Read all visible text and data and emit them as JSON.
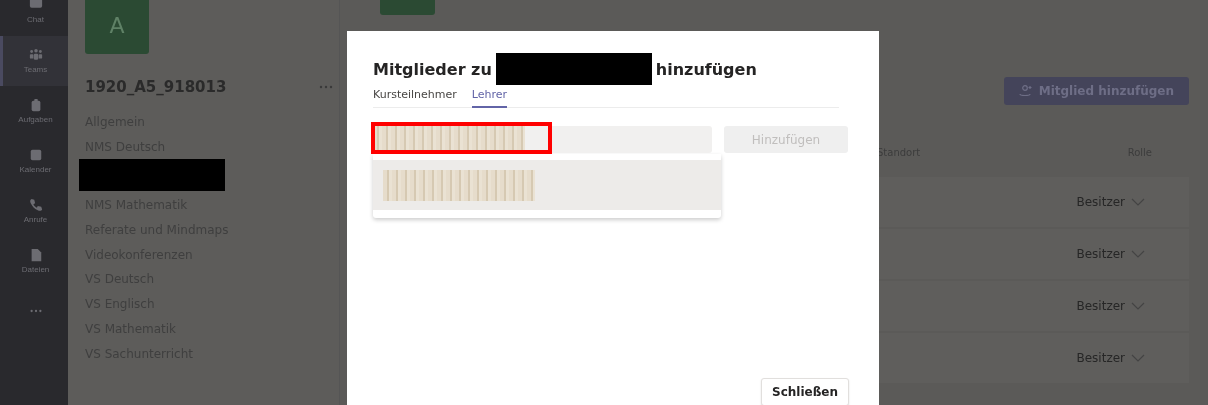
{
  "rail": {
    "items": [
      {
        "kind": "app",
        "label": "Chat",
        "selected": false
      },
      {
        "kind": "app",
        "label": "Teams",
        "selected": true
      },
      {
        "kind": "app",
        "label": "Aufgaben",
        "selected": false
      },
      {
        "kind": "app",
        "label": "Kalender",
        "selected": false
      },
      {
        "kind": "app",
        "label": "Anrufe",
        "selected": false
      },
      {
        "kind": "app",
        "label": "Dateien",
        "selected": false
      },
      {
        "kind": "more"
      }
    ]
  },
  "team": {
    "avatar": "A",
    "name": "1920_A5_918013",
    "channels": [
      {
        "kind": "text",
        "label": "Allgemein"
      },
      {
        "kind": "text",
        "label": "NMS Deutsch"
      },
      {
        "kind": "redacted"
      },
      {
        "kind": "text",
        "label": "NMS Mathematik"
      },
      {
        "kind": "text",
        "label": "Referate und Mindmaps"
      },
      {
        "kind": "text",
        "label": "Videokonferenzen"
      },
      {
        "kind": "text",
        "label": "VS Deutsch"
      },
      {
        "kind": "text",
        "label": "VS Englisch"
      },
      {
        "kind": "text",
        "label": "VS Mathematik"
      },
      {
        "kind": "text",
        "label": "VS Sachunterricht"
      }
    ]
  },
  "members": {
    "add_button": "Mitglied hinzufügen",
    "columns": [
      {
        "label": "Standort"
      },
      {
        "label": "Rolle"
      }
    ],
    "rows": [
      {
        "role": "Besitzer"
      },
      {
        "role": "Besitzer"
      },
      {
        "role": "Besitzer"
      },
      {
        "role": "Besitzer"
      }
    ]
  },
  "dialog": {
    "title_before": "Mitglieder zu",
    "title_after": "hinzufügen",
    "tabs": [
      {
        "label": "Kursteilnehmer",
        "selected": false
      },
      {
        "label": "Lehrer",
        "selected": true
      }
    ],
    "search": {
      "highlighted": true
    },
    "add_button": {
      "label": "Hinzufügen",
      "disabled": true
    },
    "suggestions": [
      {
        "selected": true
      }
    ],
    "close_button": "Schließen"
  }
}
